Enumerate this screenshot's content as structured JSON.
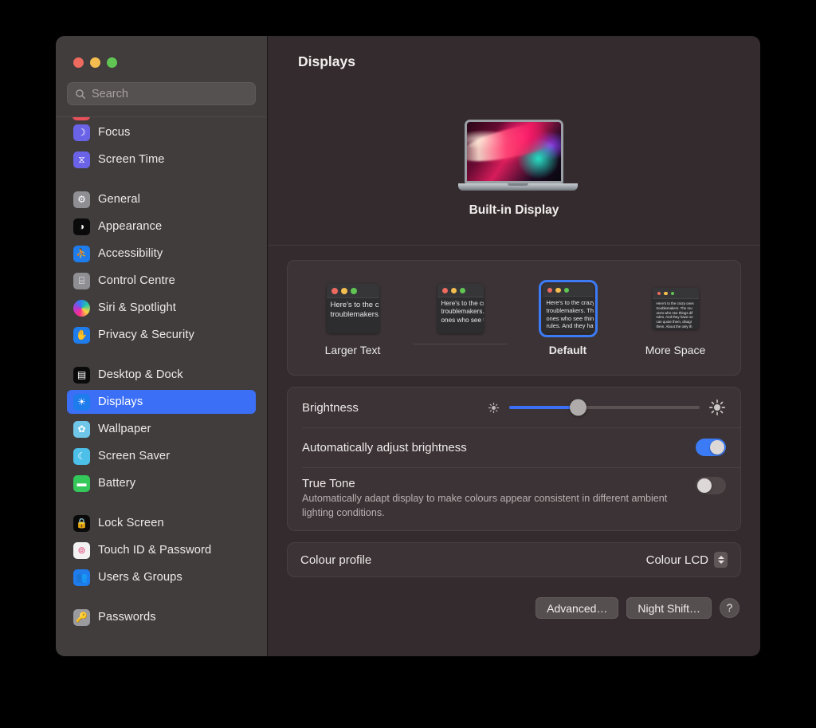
{
  "window": {
    "traffic_lights": [
      "close",
      "minimise",
      "zoom"
    ],
    "search": {
      "placeholder": "Search",
      "value": "",
      "icon": "search-icon"
    }
  },
  "sidebar": {
    "groups": [
      {
        "items": [
          {
            "label": "Focus",
            "icon": "focus-icon",
            "icon_bg": "#6a63e8",
            "glyph": "☽",
            "selected": false
          },
          {
            "label": "Screen Time",
            "icon": "screen-time-icon",
            "icon_bg": "#6a63e8",
            "glyph": "⧖",
            "selected": false
          }
        ]
      },
      {
        "items": [
          {
            "label": "General",
            "icon": "general-icon",
            "icon_bg": "#8e8e93",
            "glyph": "⚙",
            "selected": false
          },
          {
            "label": "Appearance",
            "icon": "appearance-icon",
            "icon_bg": "#0a0a0a",
            "glyph": "◑",
            "selected": false
          },
          {
            "label": "Accessibility",
            "icon": "accessibility-icon",
            "icon_bg": "#1f7ced",
            "glyph": "⛹",
            "selected": false
          },
          {
            "label": "Control Centre",
            "icon": "control-centre-icon",
            "icon_bg": "#8e8e93",
            "glyph": "⌸",
            "selected": false
          },
          {
            "label": "Siri & Spotlight",
            "icon": "siri-icon",
            "icon_bg": "#b23ad0",
            "glyph": "",
            "selected": false
          },
          {
            "label": "Privacy & Security",
            "icon": "privacy-icon",
            "icon_bg": "#1f7ced",
            "glyph": "✋",
            "selected": false
          }
        ]
      },
      {
        "items": [
          {
            "label": "Desktop & Dock",
            "icon": "desktop-dock-icon",
            "icon_bg": "#0a0a0a",
            "glyph": "▤",
            "selected": false
          },
          {
            "label": "Displays",
            "icon": "displays-icon",
            "icon_bg": "#1f7ced",
            "glyph": "☀",
            "selected": true
          },
          {
            "label": "Wallpaper",
            "icon": "wallpaper-icon",
            "icon_bg": "#6fc6e8",
            "glyph": "✿",
            "selected": false
          },
          {
            "label": "Screen Saver",
            "icon": "screen-saver-icon",
            "icon_bg": "#4cc0e8",
            "glyph": "☾",
            "selected": false
          },
          {
            "label": "Battery",
            "icon": "battery-icon",
            "icon_bg": "#34c759",
            "glyph": "▬",
            "selected": false
          }
        ]
      },
      {
        "items": [
          {
            "label": "Lock Screen",
            "icon": "lock-screen-icon",
            "icon_bg": "#0a0a0a",
            "glyph": "🔒",
            "selected": false
          },
          {
            "label": "Touch ID & Password",
            "icon": "touch-id-icon",
            "icon_bg": "#f2f2f2",
            "glyph": "⊚",
            "selected": false
          },
          {
            "label": "Users & Groups",
            "icon": "users-groups-icon",
            "icon_bg": "#1f7ced",
            "glyph": "👥",
            "selected": false
          }
        ]
      },
      {
        "items": [
          {
            "label": "Passwords",
            "icon": "passwords-icon",
            "icon_bg": "#9a9a9f",
            "glyph": "🔑",
            "selected": false
          }
        ]
      }
    ]
  },
  "main": {
    "title": "Displays",
    "display": {
      "name": "Built-in Display",
      "device": "macbook-pro"
    },
    "resolutions": {
      "preview_text": [
        "Here's to the crazy",
        "troublemakers. The",
        "ones who see thing",
        "rules. And they"
      ],
      "options": [
        {
          "label": "Larger Text",
          "selected": false,
          "scale": "largest"
        },
        {
          "label": "",
          "selected": false,
          "scale": "larger"
        },
        {
          "label": "Default",
          "selected": true,
          "scale": "default"
        },
        {
          "label": "More Space",
          "selected": false,
          "scale": "more-space"
        }
      ]
    },
    "brightness": {
      "label": "Brightness",
      "value_percent": 36,
      "low_icon": "brightness-low-icon",
      "high_icon": "brightness-high-icon"
    },
    "auto_brightness": {
      "label": "Automatically adjust brightness",
      "enabled": true
    },
    "true_tone": {
      "label": "True Tone",
      "description": "Automatically adapt display to make colours appear consistent in different ambient lighting conditions.",
      "enabled": false
    },
    "colour_profile": {
      "label": "Colour profile",
      "value": "Colour LCD"
    },
    "buttons": {
      "advanced": "Advanced…",
      "night_shift": "Night Shift…",
      "help": "?"
    }
  },
  "colors": {
    "accent": "#3b7bf6",
    "sidebar_bg": "#413d3d",
    "main_bg": "#332b2d",
    "card_bg": "#3b3335"
  }
}
